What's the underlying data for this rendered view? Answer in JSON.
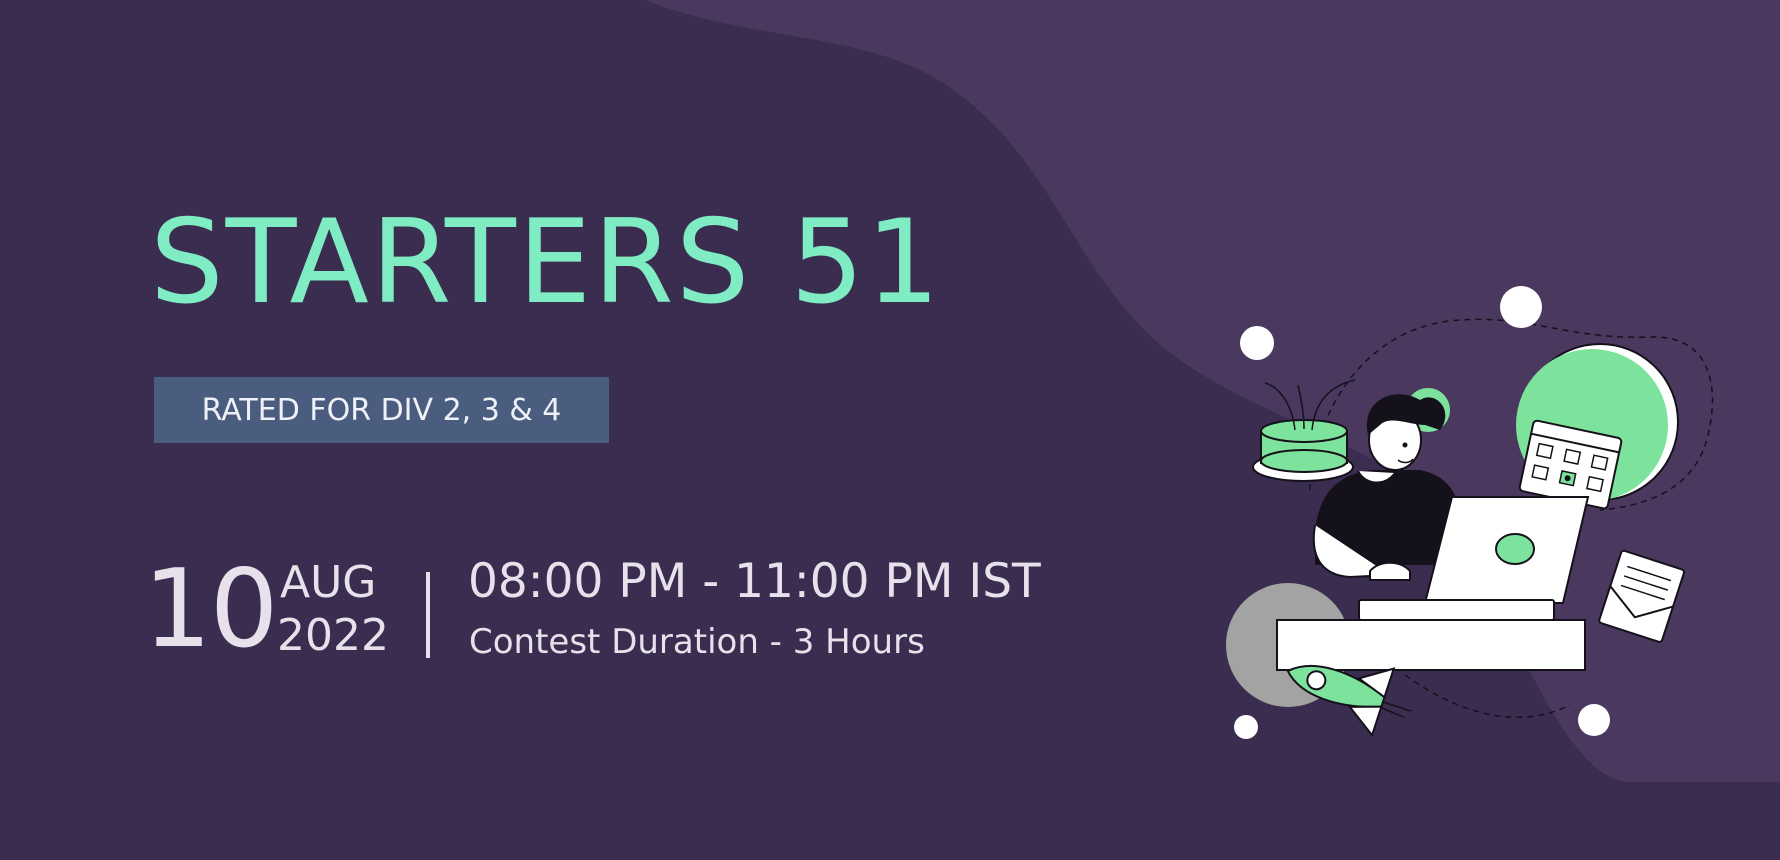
{
  "banner": {
    "title": "STARTERS 51",
    "badge": "RATED FOR DIV 2, 3 & 4",
    "date": {
      "day": "10",
      "month": "AUG",
      "year": "2022"
    },
    "time_range": "08:00 PM - 11:00 PM IST",
    "duration": "Contest Duration - 3 Hours"
  },
  "colors": {
    "background": "#3b2d50",
    "background_blob": "#4b385f",
    "title": "#7fecc3",
    "badge_background": "#4b5d7f",
    "text": "#e6e1ea",
    "illustration_accent": "#7de39c"
  },
  "illustration": {
    "subject": "person-working-on-laptop-illustration",
    "icons": [
      "cake-icon",
      "calendar-icon",
      "rocket-icon",
      "envelope-icon",
      "laptop-icon"
    ]
  }
}
